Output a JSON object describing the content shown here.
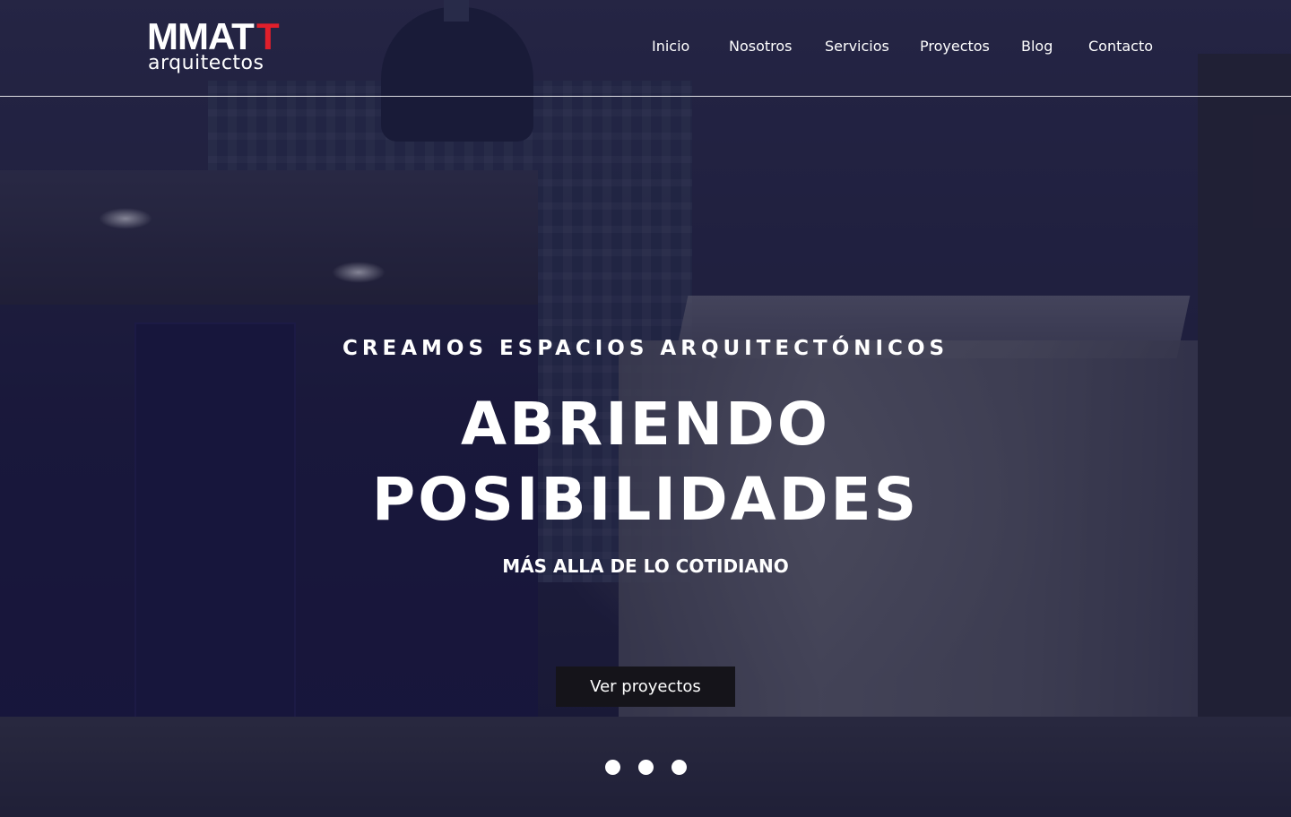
{
  "brand": {
    "name_main": "MMAT",
    "name_accent": "T",
    "name_sub": "arquitectos",
    "accent_color": "#e01f2b"
  },
  "nav": {
    "items": [
      "Inicio",
      "Nosotros",
      "Servicios",
      "Proyectos",
      "Blog",
      "Contacto"
    ]
  },
  "hero": {
    "eyebrow": "CREAMOS ESPACIOS ARQUITECTÓNICOS",
    "headline_line1": "ABRIENDO",
    "headline_line2": "POSIBILIDADES",
    "tagline": "MÁS ALLA DE LO COTIDIANO",
    "cta_label": "Ver proyectos"
  },
  "slider": {
    "slide_count": 3
  }
}
